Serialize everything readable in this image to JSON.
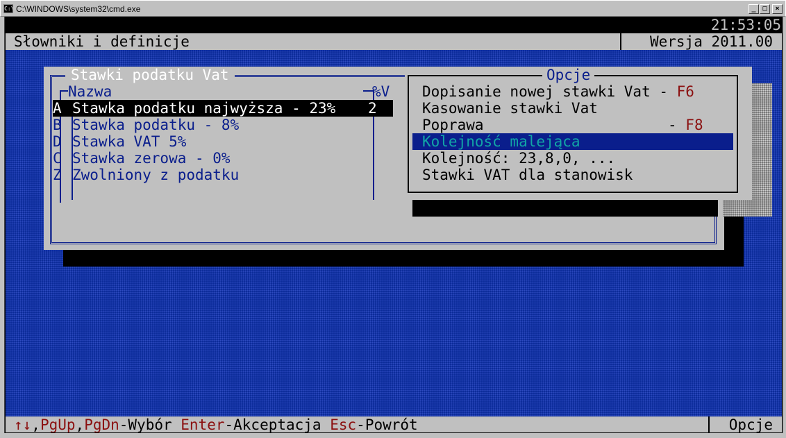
{
  "window": {
    "title": "C:\\WINDOWS\\system32\\cmd.exe",
    "icon_text": "C:\\",
    "buttons": {
      "minimize": "_",
      "maximize": "□",
      "close": "×"
    }
  },
  "status": {
    "clock": "21:53:05"
  },
  "header": {
    "title": "Słowniki i definicje",
    "version": "Wersja 2011.00"
  },
  "vat_panel": {
    "title": "Stawki podatku Vat",
    "columns": {
      "name": "Nazwa",
      "value": "%V"
    },
    "rows": [
      {
        "key": "A",
        "name": "Stawka podatku najwyższa - 23%",
        "value": "2"
      },
      {
        "key": "B",
        "name": "Stawka podatku - 8%",
        "value": ""
      },
      {
        "key": "D",
        "name": "Stawka VAT 5%",
        "value": ""
      },
      {
        "key": "C",
        "name": "Stawka zerowa - 0%",
        "value": ""
      },
      {
        "key": "Z",
        "name": "Zwolniony z podatku",
        "value": ""
      }
    ]
  },
  "options_panel": {
    "title": "Opcje",
    "items": [
      {
        "label": "Dopisanie nowej stawki Vat - ",
        "key": "F6"
      },
      {
        "label": "Kasowanie stawki Vat",
        "key": ""
      },
      {
        "label": "Poprawa                     - ",
        "key": "F8"
      },
      {
        "label": "Kolejność malejąca",
        "key": ""
      },
      {
        "label": "Kolejność: 23,8,0, ...",
        "key": ""
      },
      {
        "label": "Stawki VAT dla stanowisk",
        "key": ""
      }
    ]
  },
  "footer": {
    "arrows": "↑↓",
    "pgup": "PgUp",
    "pgdn": "PgDn",
    "select": "-Wybór",
    "enter": "Enter",
    "accept": "-Akceptacja",
    "esc": "Esc",
    "back": "-Powrót",
    "options": "Opcje"
  }
}
